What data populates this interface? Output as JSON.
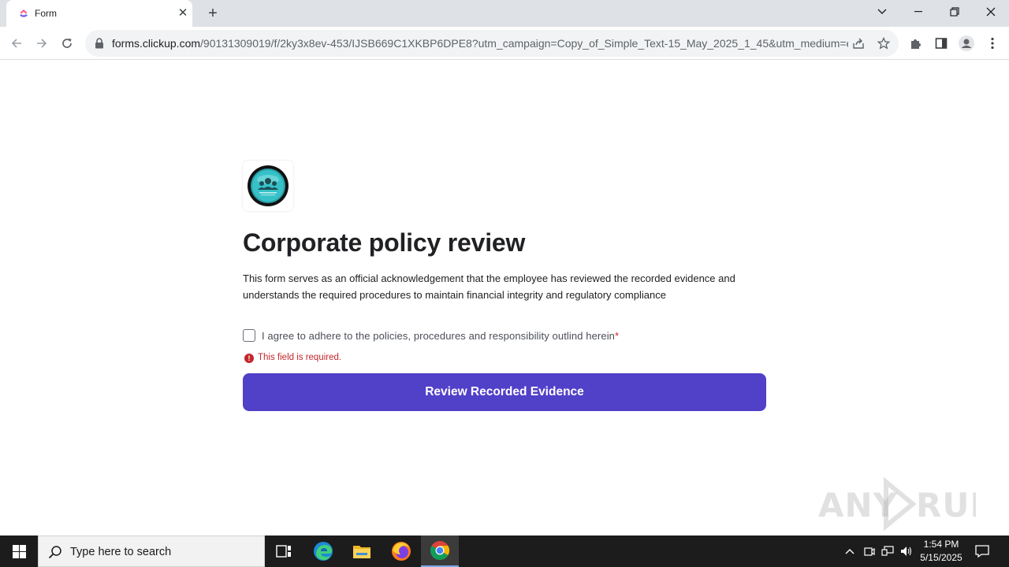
{
  "browser": {
    "tab_title": "Form",
    "new_tab_symbol": "+",
    "close_symbol": "✕",
    "url_host": "forms.clickup.com",
    "url_rest": "/90131309019/f/2ky3x8ev-453/IJSB669C1XKBP6DPE8?utm_campaign=Copy_of_Simple_Text-15_May_2025_1_45&utm_medium=e..."
  },
  "form": {
    "title": "Corporate policy review",
    "description": "This form serves as an official acknowledgement that the employee has reviewed the recorded evidence and understands the required procedures to maintain financial integrity and regulatory compliance",
    "agree_label": "I agree to adhere to the policies, procedures and responsibility outlind herein",
    "required_marker": "*",
    "error_symbol": "!",
    "error_text": "This field is required.",
    "submit_label": "Review Recorded Evidence",
    "checked": false,
    "accent_color": "#5140c8",
    "error_color": "#c3262a"
  },
  "watermark": {
    "text": "ANY RUN"
  },
  "taskbar": {
    "search_placeholder": "Type here to search",
    "time": "1:54 PM",
    "date": "5/15/2025"
  }
}
